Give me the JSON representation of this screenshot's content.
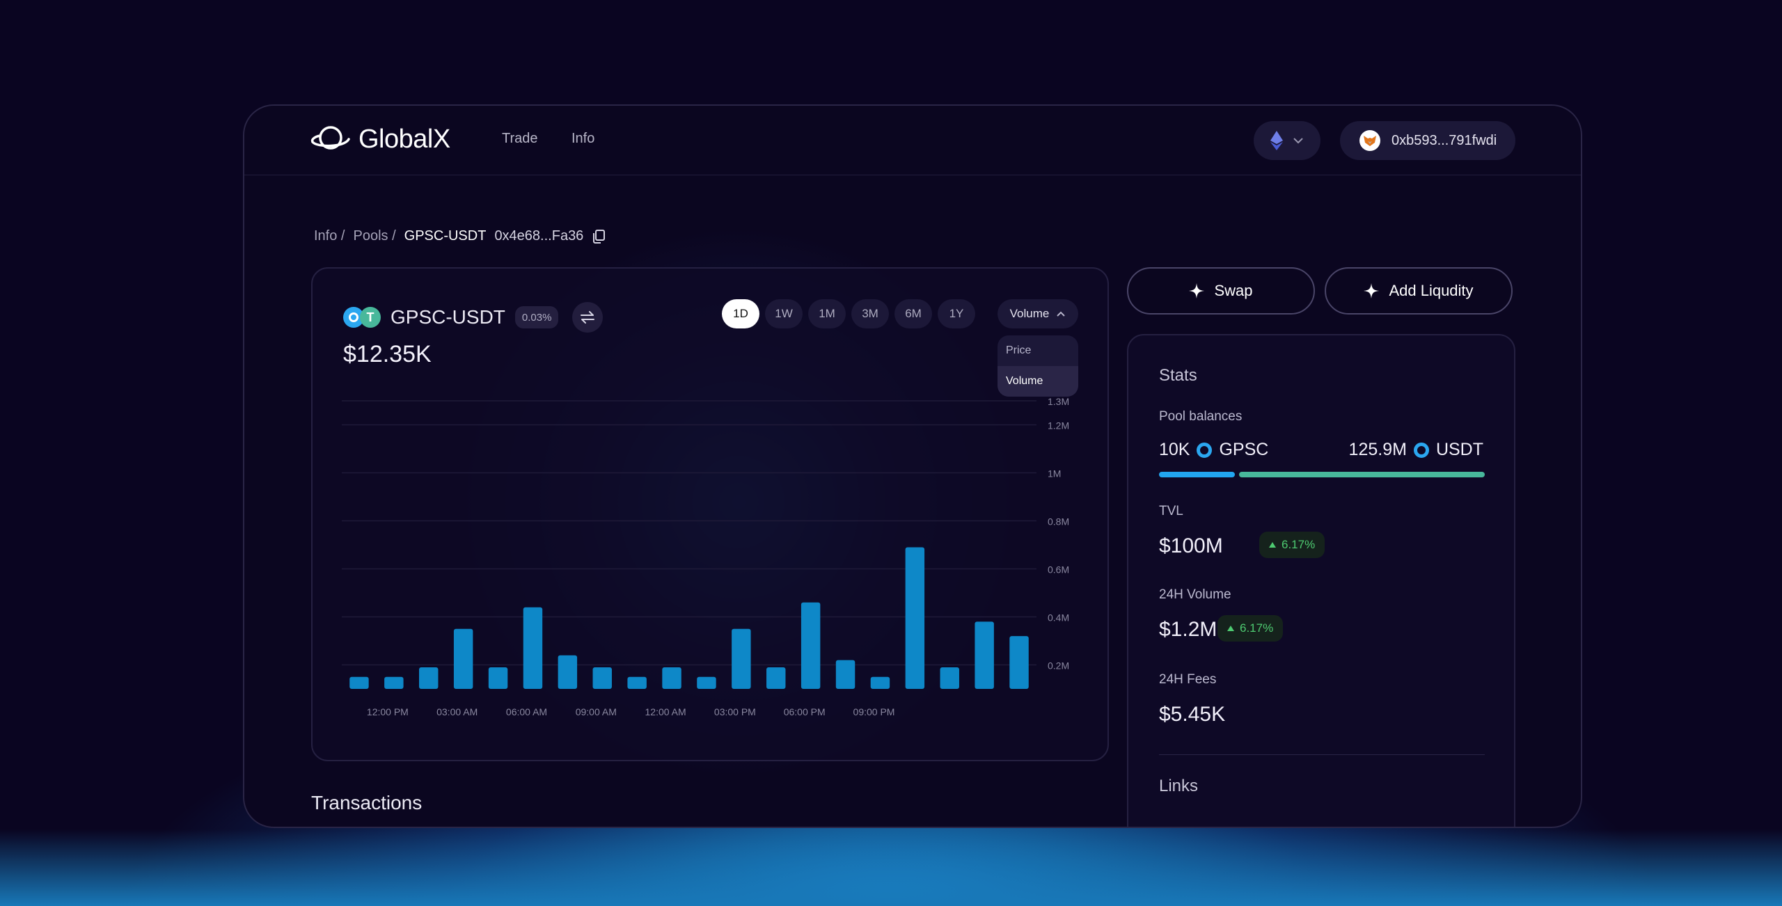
{
  "app": {
    "brand": "GlobalX"
  },
  "nav": {
    "trade": "Trade",
    "info": "Info"
  },
  "wallet": {
    "address": "0xb593...791fwdi"
  },
  "breadcrumb": {
    "info": "Info /",
    "pools": "Pools /",
    "current": "GPSC-USDT",
    "address": "0x4e68...Fa36"
  },
  "pool": {
    "name": "GPSC-USDT",
    "fee": "0.03%",
    "value": "$12.35K"
  },
  "ranges": [
    "1D",
    "1W",
    "1M",
    "3M",
    "6M",
    "1Y"
  ],
  "active_range": "1D",
  "metric": {
    "selected": "Volume",
    "options": [
      "Price",
      "Volume"
    ]
  },
  "actions": {
    "swap": "Swap",
    "add_liquidity": "Add Liqudity"
  },
  "stats": {
    "title": "Stats",
    "pool_balances_label": "Pool balances",
    "balance_a": {
      "amount": "10K",
      "token": "GPSC"
    },
    "balance_b": {
      "amount": "125.9M",
      "token": "USDT"
    },
    "balance_share_a": 0.235,
    "tvl_label": "TVL",
    "tvl": "$100M",
    "tvl_change": "6.17%",
    "volume_label": "24H Volume",
    "volume": "$1.2M",
    "volume_change": "6.17%",
    "fees_label": "24H  Fees",
    "fees": "$5.45K",
    "links_title": "Links"
  },
  "transactions_title": "Transactions",
  "colors": {
    "bar": "#0e88c8",
    "accent_green": "#4ecb71",
    "usdt": "#48b89b",
    "gpsc": "#22a6f0"
  },
  "chart_data": {
    "type": "bar",
    "x_tick_labels": [
      "12:00 PM",
      "03:00 AM",
      "06:00 AM",
      "09:00 AM",
      "12:00 AM",
      "03:00 PM",
      "06:00 PM",
      "09:00 PM"
    ],
    "y_tick_labels": [
      "0.2M",
      "0.4M",
      "0.6M",
      "0.8M",
      "1M",
      "1.2M",
      "1.3M"
    ],
    "values": [
      0.15,
      0.15,
      0.19,
      0.35,
      0.19,
      0.44,
      0.24,
      0.19,
      0.15,
      0.19,
      0.15,
      0.35,
      0.19,
      0.46,
      0.22,
      0.15,
      0.69,
      0.19,
      0.38,
      0.32
    ],
    "ylim": [
      0.1,
      1.3
    ],
    "grid": true
  }
}
